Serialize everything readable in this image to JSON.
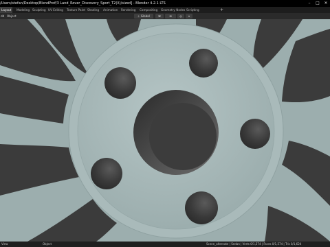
{
  "window": {
    "title": "/Users/stefan/Desktop/BlendProf/3 Land_Rover_Discovery_Sport_T2(X)/sized] - Blender 4.2.1 LTS",
    "controls": {
      "minimize": "–",
      "maximize": "□",
      "close": "✕"
    }
  },
  "workspace_tabs": [
    {
      "label": "Layout",
      "active": true
    },
    {
      "label": "Modeling",
      "active": false
    },
    {
      "label": "Sculpting",
      "active": false
    },
    {
      "label": "UV Editing",
      "active": false
    },
    {
      "label": "Texture Paint",
      "active": false
    },
    {
      "label": "Shading",
      "active": false
    },
    {
      "label": "Animation",
      "active": false
    },
    {
      "label": "Rendering",
      "active": false
    },
    {
      "label": "Compositing",
      "active": false
    },
    {
      "label": "Geometry Nodes",
      "active": false
    },
    {
      "label": "Scripting",
      "active": false
    }
  ],
  "add_tab_label": "+",
  "header": {
    "menus": [
      "dd",
      "Object"
    ],
    "transform_orientation": "Global"
  },
  "status": {
    "left_label": "View",
    "middle_label": "Object",
    "right_text": "Scene_alternate | Sedan | Verts 0/1,574 | Faces 0/1,574 | Tris 0/1,624"
  },
  "colors": {
    "viewport_bg": "#9fb0b0",
    "wheel_face": "#9caeae",
    "spoke_gap": "#3b3b3b",
    "hub_rim": "#acbebe"
  }
}
